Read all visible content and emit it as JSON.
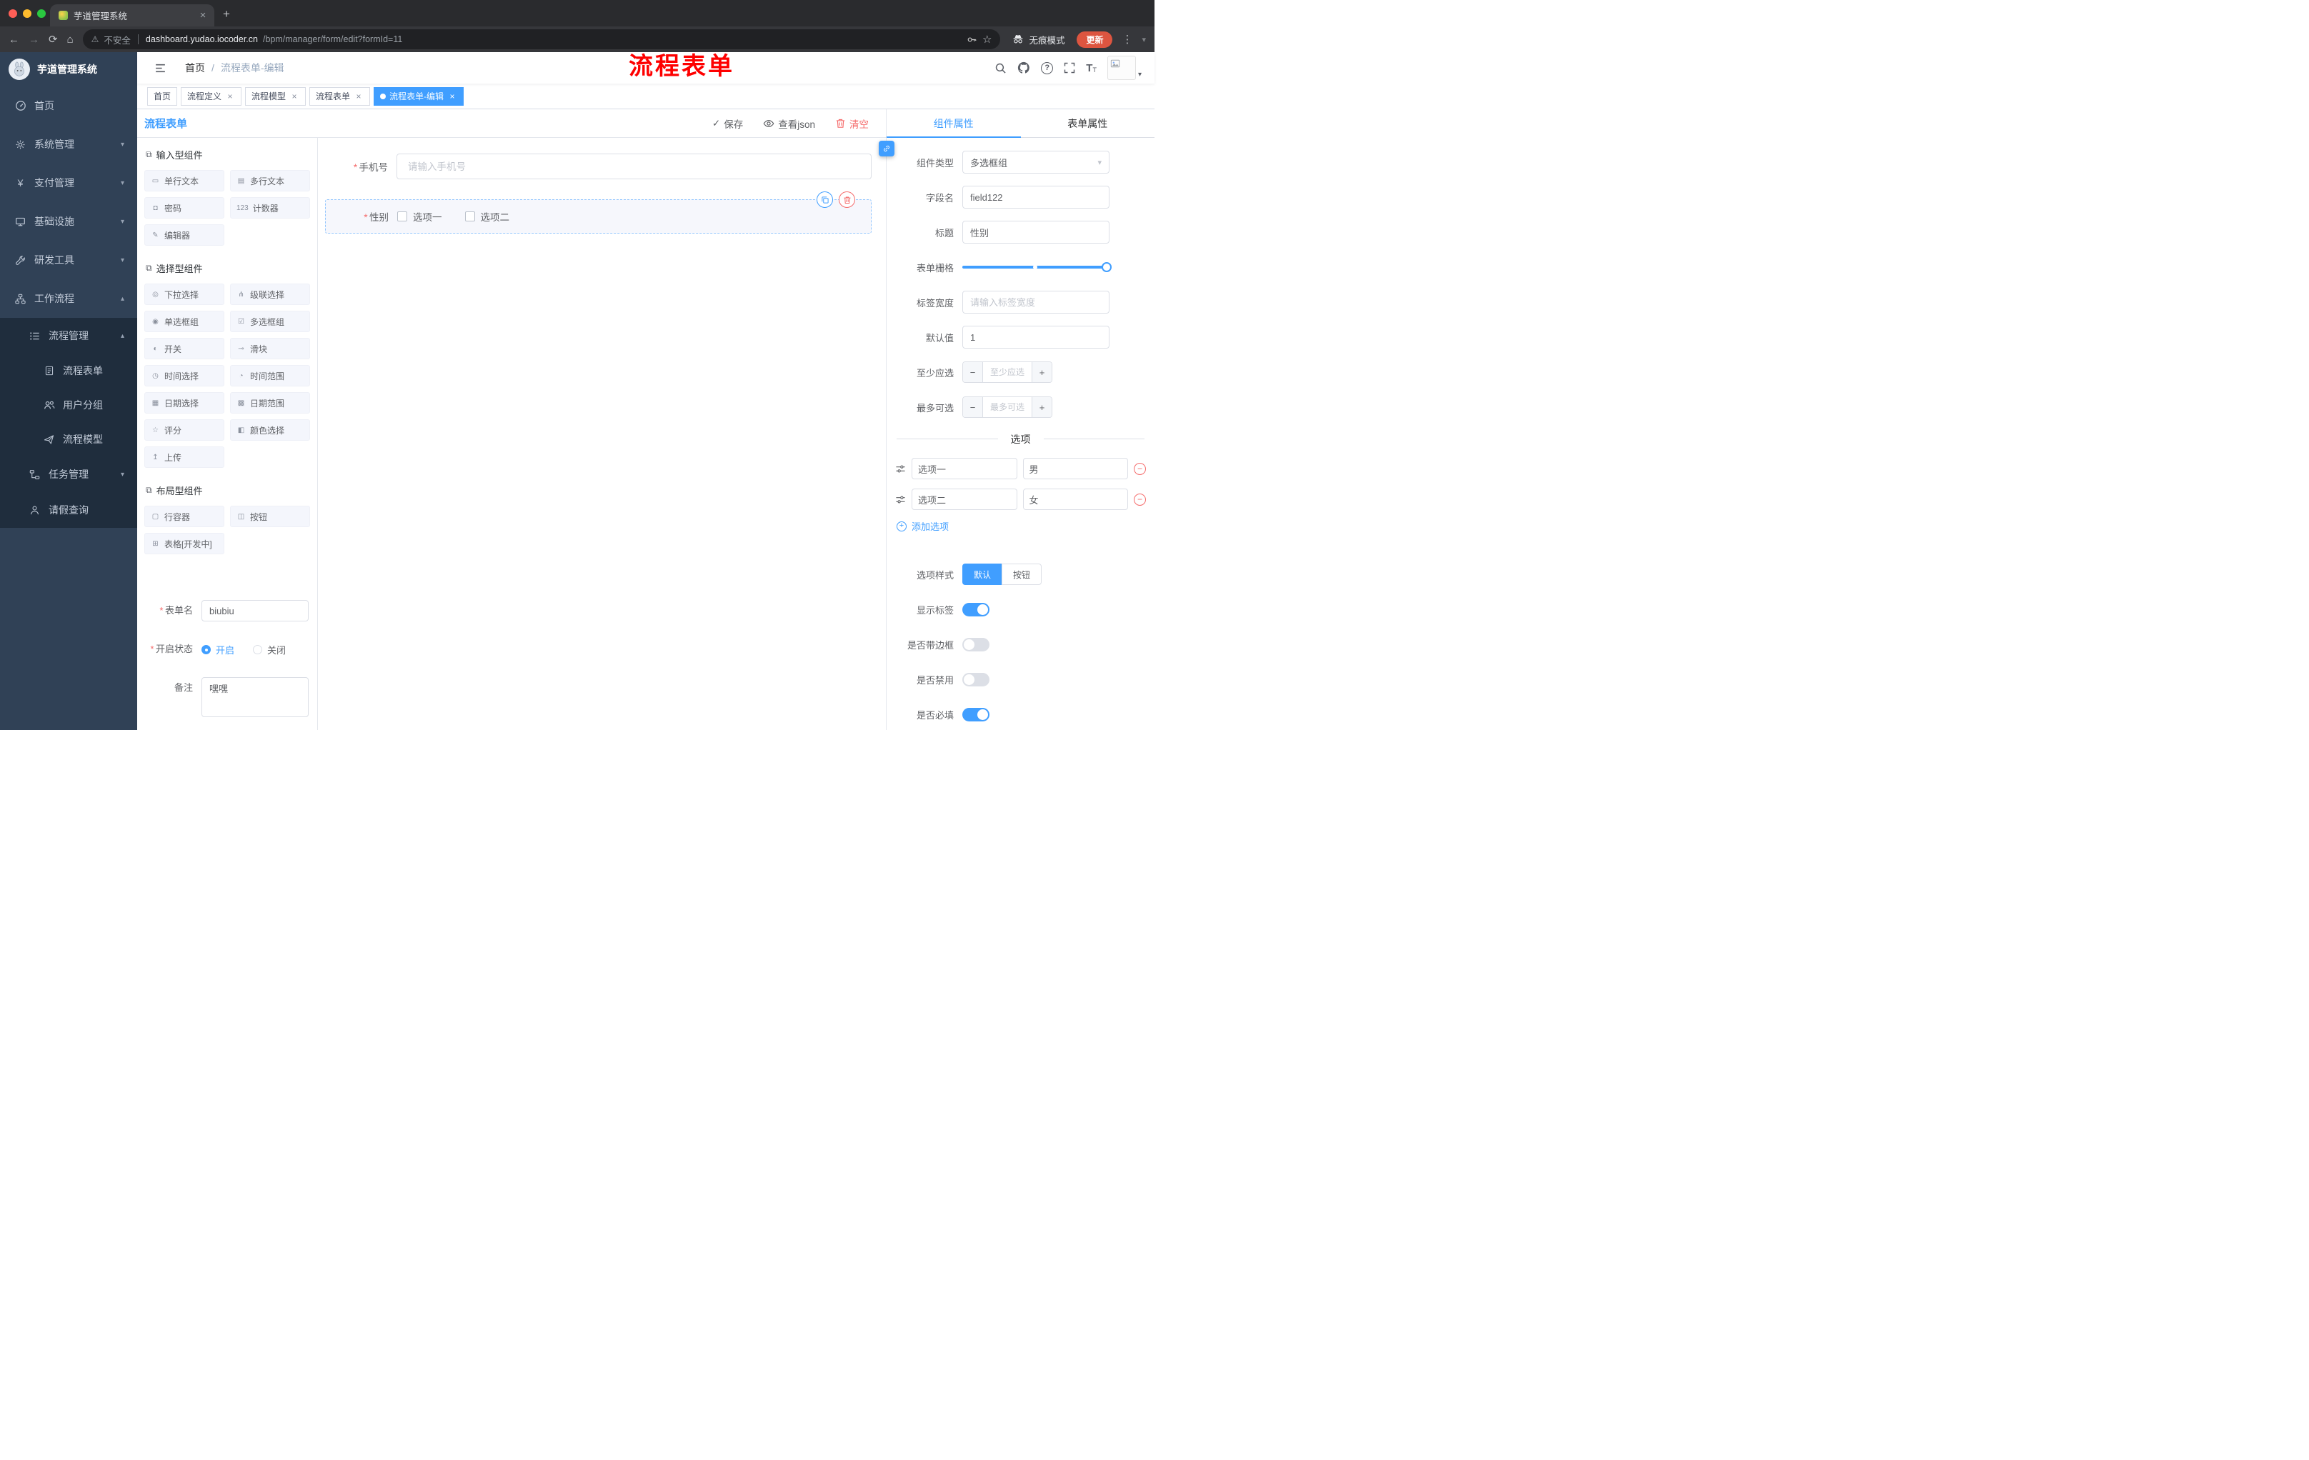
{
  "colors": {
    "accent": "#409eff",
    "danger": "#f56c6c",
    "sidebar_bg": "#304156",
    "submenu_bg": "#1f2d3d",
    "annotation": "#ff0000"
  },
  "browser": {
    "tab_title": "芋道管理系统",
    "security_label": "不安全",
    "url_host": "dashboard.yudao.iocoder.cn",
    "url_path": "/bpm/manager/form/edit?formId=11",
    "incognito_label": "无痕模式",
    "update_label": "更新"
  },
  "annotation_text": "流程表单",
  "sidebar": {
    "logo_title": "芋道管理系统",
    "menu": [
      {
        "label": "首页"
      },
      {
        "label": "系统管理"
      },
      {
        "label": "支付管理"
      },
      {
        "label": "基础设施"
      },
      {
        "label": "研发工具"
      },
      {
        "label": "工作流程"
      },
      {
        "label": "流程管理"
      },
      {
        "label": "流程表单"
      },
      {
        "label": "用户分组"
      },
      {
        "label": "流程模型"
      },
      {
        "label": "任务管理"
      },
      {
        "label": "请假查询"
      }
    ]
  },
  "navbar": {
    "breadcrumb_home": "首页",
    "breadcrumb_sep": "/",
    "breadcrumb_current": "流程表单-编辑"
  },
  "tags": [
    {
      "label": "首页"
    },
    {
      "label": "流程定义"
    },
    {
      "label": "流程模型"
    },
    {
      "label": "流程表单"
    },
    {
      "label": "流程表单-编辑"
    }
  ],
  "designer": {
    "title": "流程表单",
    "save_label": "保存",
    "view_json_label": "查看json",
    "clear_label": "清空",
    "palette": [
      {
        "title": "输入型组件",
        "items": [
          "单行文本",
          "多行文本",
          "密码",
          "计数器",
          "编辑器"
        ]
      },
      {
        "title": "选择型组件",
        "items": [
          "下拉选择",
          "级联选择",
          "单选框组",
          "多选框组",
          "开关",
          "滑块",
          "时间选择",
          "时间范围",
          "日期选择",
          "日期范围",
          "评分",
          "颜色选择",
          "上传"
        ]
      },
      {
        "title": "布局型组件",
        "items": [
          "行容器",
          "按钮",
          "表格[开发中]"
        ]
      }
    ],
    "meta": {
      "form_name_label": "表单名",
      "form_name_value": "biubiu",
      "status_label": "开启状态",
      "status_on": "开启",
      "status_off": "关闭",
      "remark_label": "备注",
      "remark_value": "嘿嘿"
    }
  },
  "canvas": {
    "phone_label": "手机号",
    "phone_placeholder": "请输入手机号",
    "gender_label": "性别",
    "gender_options": [
      "选项一",
      "选项二"
    ]
  },
  "props": {
    "tab_component": "组件属性",
    "tab_form": "表单属性",
    "component_type_label": "组件类型",
    "component_type_value": "多选框组",
    "field_name_label": "字段名",
    "field_name_value": "field122",
    "title_label": "标题",
    "title_value": "性别",
    "grid_label": "表单栅格",
    "label_width_label": "标签宽度",
    "label_width_placeholder": "请输入标签宽度",
    "default_label": "默认值",
    "default_value": "1",
    "min_label": "至少应选",
    "min_placeholder": "至少应选",
    "max_label": "最多可选",
    "max_placeholder": "最多可选",
    "options_title": "选项",
    "options": [
      {
        "label": "选项一",
        "value": "男"
      },
      {
        "label": "选项二",
        "value": "女"
      }
    ],
    "add_option_label": "添加选项",
    "style_label": "选项样式",
    "style_default": "默认",
    "style_button": "按钮",
    "toggle_show_label": "显示标签",
    "toggle_border": "是否带边框",
    "toggle_disabled": "是否禁用",
    "toggle_required": "是否必填"
  },
  "icons": {
    "back": "←",
    "forward": "→",
    "reload": "⟳",
    "home": "⌂",
    "warning": "⚠",
    "star": "☆",
    "kebab": "⋮",
    "caret_down": "▾",
    "caret_up": "▴",
    "close": "×",
    "plus": "+",
    "minus": "−",
    "yen": "¥",
    "check": "✓",
    "font_size": "T",
    "question": "?",
    "cube": "⧉",
    "palette_glyphs": [
      "▭",
      "▤",
      "◘",
      "123",
      "✎",
      "◎",
      "⋔",
      "◉",
      "☑",
      "◐",
      "⊸",
      "◷",
      "◔",
      "▦",
      "▩",
      "☆",
      "◧",
      "↥",
      "▢",
      "◫",
      "⊞"
    ]
  }
}
